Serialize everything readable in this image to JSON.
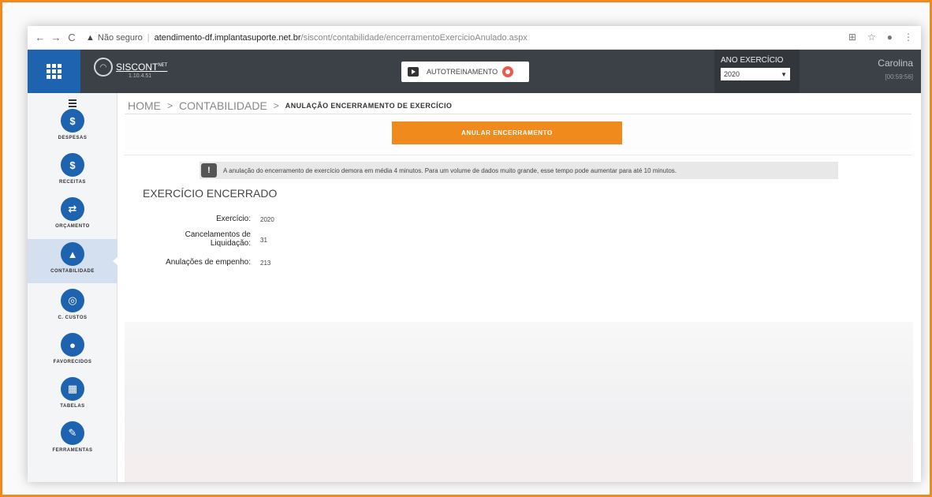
{
  "browser": {
    "warning": "Não seguro",
    "url_domain": "atendimento-df.implantasuporte.net.br",
    "url_path": "/siscont/contabilidade/encerramentoExercicioAnulado.aspx"
  },
  "header": {
    "logo": "SISCONT",
    "logo_suffix": "NET",
    "version": "1.10.4.51",
    "autotraining_label": "AUTOTREINAMENTO",
    "year_label": "ANO EXERCÍCIO",
    "year_value": "2020",
    "user_name": "Carolina",
    "session_timer": "[00:59:56]"
  },
  "sidebar": {
    "items": [
      {
        "label": "DESPESAS",
        "icon": "$"
      },
      {
        "label": "RECEITAS",
        "icon": "$"
      },
      {
        "label": "ORÇAMENTO",
        "icon": "⇄"
      },
      {
        "label": "CONTABILIDADE",
        "icon": "▲"
      },
      {
        "label": "C. CUSTOS",
        "icon": "◎"
      },
      {
        "label": "FAVORECIDOS",
        "icon": "●"
      },
      {
        "label": "TABELAS",
        "icon": "▦"
      },
      {
        "label": "FERRAMENTAS",
        "icon": "✎"
      }
    ]
  },
  "breadcrumb": {
    "home": "HOME",
    "section": "CONTABILIDADE",
    "current": "ANULAÇÃO ENCERRAMENTO DE EXERCÍCIO"
  },
  "main": {
    "annul_button": "ANULAR ENCERRAMENTO",
    "notice": "A anulação do encerramento de exercício demora em média 4 minutos. Para um volume de dados muito grande, esse tempo pode aumentar para até 10 minutos.",
    "section_title": "EXERCÍCIO ENCERRADO",
    "fields": [
      {
        "label": "Exercício:",
        "value": "2020"
      },
      {
        "label": "Cancelamentos de Liquidação:",
        "value": "31"
      },
      {
        "label": "Anulações de empenho:",
        "value": "213"
      }
    ]
  },
  "colors": {
    "brand_blue": "#1e63b0",
    "accent_orange": "#f08a1c",
    "header_dark": "#3c4147"
  }
}
